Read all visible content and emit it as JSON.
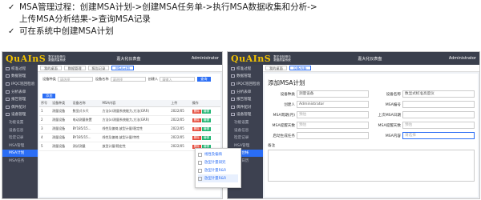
{
  "bullets": {
    "line1": "MSA管理过程：创建MSA计划->创建MSA任务单->执行MSA数据收集和分析->",
    "line2": "上传MSA分析结果->查询MSA记录",
    "line3": "可在系统中创建MSA计划",
    "check": "✓"
  },
  "app": {
    "logo": "QuAInS",
    "brand_line1": "数字化检测与",
    "brand_line2": "数据质量系统",
    "header_center": "嘉大化仪表盘",
    "user": "Administrator"
  },
  "left": {
    "sidebar": [
      "校准过程",
      "数据管理",
      "IPQC巡回检验",
      "分析表单",
      "报告管理",
      "偶件配对",
      "设备管理",
      "功能设置",
      "设备信息",
      "检定记录",
      "MSA管理",
      "MSA计划",
      "MSA任务"
    ],
    "tabs": [
      "我的桌面",
      "数据管理",
      "报告记录",
      "MSA计划"
    ],
    "filters": {
      "f1_label": "设备种类",
      "f1_ph": "请选择",
      "f2_label": "设备名称",
      "f2_ph": "请选择",
      "f3_label": "创建人",
      "f3_ph": "请输入",
      "query": "查询"
    },
    "add_label": "添加",
    "columns": [
      "序号",
      "设备种类",
      "设备名称",
      "MSA内容",
      "上传",
      "操作"
    ],
    "rows": [
      [
        "1",
        "测量设备",
        "数显式卡尺",
        "方法(x)测量系统能力,方法(GRR)",
        "2022/05"
      ],
      [
        "2",
        "测量设备",
        "电动测量装置",
        "方法(x)测量系统能力,方法(GRR)",
        "2022/05"
      ],
      [
        "3",
        "测量设备",
        "BY185/15...",
        "线性及偏倚,放型计量/稳定性",
        "2022/05"
      ],
      [
        "4",
        "测量设备",
        "BY185/15...",
        "线性及偏倚,放型计量/特性",
        "2022/05"
      ],
      [
        "5",
        "测量设备",
        "测试测量",
        "放型计量/稳定性",
        "2022/05"
      ]
    ],
    "op_edit": "编辑",
    "op_del": "删除"
  },
  "right": {
    "sidebar": [
      "校准过程",
      "数据管理",
      "IPQC巡回检验",
      "分析表单",
      "报告管理",
      "偶件配对",
      "设备管理",
      "功能设置",
      "设备信息",
      "检定记录",
      "MSA管理",
      "设备台帐",
      "工作日历"
    ],
    "tabs": [
      "我的桌面",
      "设备台帐"
    ],
    "title": "添加MSA计划",
    "fields": [
      {
        "label": "设备种类",
        "value": "测量设备"
      },
      {
        "label": "设备名称",
        "value": "数显式标准高度仪"
      },
      {
        "label": "创建人",
        "value": "Administrator"
      },
      {
        "label": "MSA编号",
        "value": ""
      },
      {
        "label": "MSA周期(月)",
        "value": "预估"
      },
      {
        "label": "上次MSA日期",
        "value": ""
      },
      {
        "label": "MSA提醒天数",
        "value": "预估"
      },
      {
        "label": "MSA提醒天数",
        "value": "预估"
      },
      {
        "label": "启动生成任务",
        "value": ""
      },
      {
        "label": "MSA内容",
        "value": "请选择"
      }
    ],
    "note_label": "备注",
    "dropdown": [
      "线性及偏倚",
      "放型计量研究",
      "放型计量R&R",
      "放型计量R&R"
    ]
  }
}
